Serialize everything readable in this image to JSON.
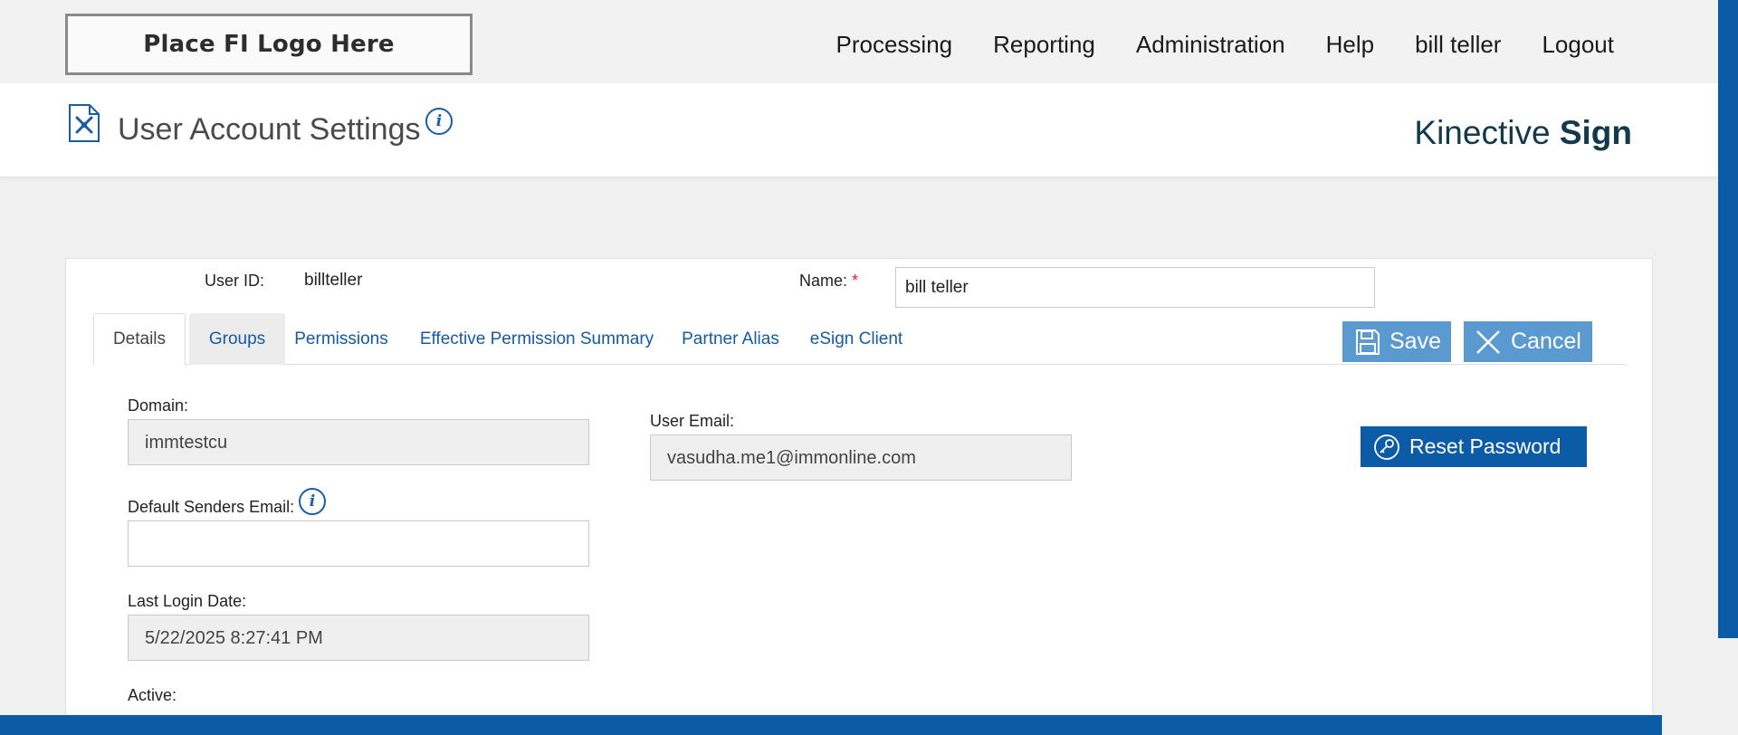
{
  "logo": {
    "text": "Place FI Logo Here"
  },
  "nav": {
    "items": [
      "Processing",
      "Reporting",
      "Administration",
      "Help",
      "bill teller",
      "Logout"
    ]
  },
  "header": {
    "title": "User Account Settings",
    "brand_light": "Kinective",
    "brand_bold": "Sign"
  },
  "user": {
    "id_label": "User ID:",
    "id_value": "billteller",
    "name_label": "Name:",
    "required_mark": "*",
    "name_value": "bill teller"
  },
  "tabs": [
    "Details",
    "Groups",
    "Permissions",
    "Effective Permission Summary",
    "Partner Alias",
    "eSign Client"
  ],
  "actions": {
    "save_label": "Save",
    "cancel_label": "Cancel",
    "reset_label": "Reset Password"
  },
  "details": {
    "domain_label": "Domain:",
    "domain_value": "immtestcu",
    "email_label": "User Email:",
    "email_value": "vasudha.me1@immonline.com",
    "senders_label": "Default Senders Email:",
    "senders_value": "",
    "last_login_label": "Last Login Date:",
    "last_login_value": "5/22/2025 8:27:41 PM",
    "active_label": "Active:"
  },
  "icons": {
    "info": "i",
    "page": "wrench-document-icon",
    "save": "floppy-disk-icon",
    "cancel": "close-icon",
    "reset": "key-icon"
  },
  "colors": {
    "primary": "#0c5ba6",
    "button": "#5b9ad1",
    "link": "#155aa3",
    "brand": "#123a4a",
    "required": "#e02020"
  }
}
